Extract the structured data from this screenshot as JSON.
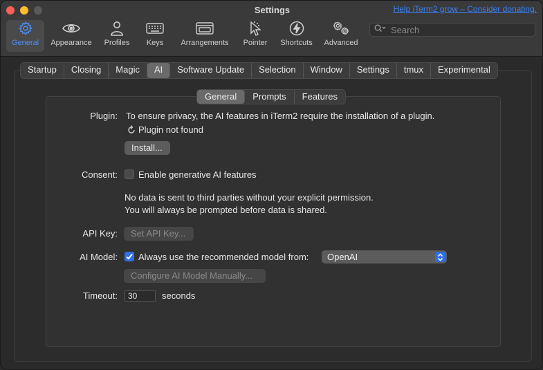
{
  "window": {
    "title": "Settings",
    "donate_link": "Help iTerm2 grow – Consider donating."
  },
  "search": {
    "placeholder": "Search"
  },
  "toolbar": [
    {
      "label": "General",
      "icon": "gear-icon",
      "selected": true
    },
    {
      "label": "Appearance",
      "icon": "eye-icon"
    },
    {
      "label": "Profiles",
      "icon": "person-icon"
    },
    {
      "label": "Keys",
      "icon": "keyboard-icon"
    },
    {
      "label": "Arrangements",
      "icon": "windows-icon"
    },
    {
      "label": "Pointer",
      "icon": "pointer-icon"
    },
    {
      "label": "Shortcuts",
      "icon": "bolt-icon"
    },
    {
      "label": "Advanced",
      "icon": "gears-icon"
    }
  ],
  "tabs": [
    "Startup",
    "Closing",
    "Magic",
    "AI",
    "Software Update",
    "Selection",
    "Window",
    "Settings",
    "tmux",
    "Experimental"
  ],
  "active_tab": "AI",
  "subtabs": [
    "General",
    "Prompts",
    "Features"
  ],
  "active_subtab": "General",
  "plugin": {
    "label": "Plugin:",
    "description": "To ensure privacy, the AI features in iTerm2 require the installation of a plugin.",
    "status": "Plugin not found",
    "install_button": "Install..."
  },
  "consent": {
    "label": "Consent:",
    "checkbox_label": "Enable generative AI features",
    "checked": false,
    "note_line1": "No data is sent to third parties without your explicit permission.",
    "note_line2": "You will always be prompted before data is shared."
  },
  "api_key": {
    "label": "API Key:",
    "button": "Set API Key..."
  },
  "ai_model": {
    "label": "AI Model:",
    "checkbox_label": "Always use the recommended model from:",
    "checked": true,
    "provider": "OpenAI",
    "manual_button": "Configure AI Model Manually..."
  },
  "timeout": {
    "label": "Timeout:",
    "value": "30",
    "unit": "seconds"
  },
  "colors": {
    "accent": "#2f6fe6",
    "link": "#3b82f6",
    "selected_toolbar_text": "#4f8ff7"
  }
}
